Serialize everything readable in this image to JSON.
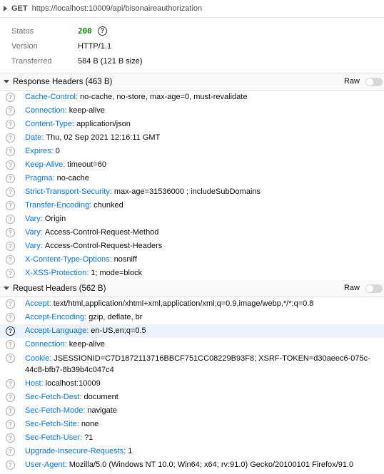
{
  "request": {
    "method": "GET",
    "url": "https://localhost:10009/api/bisonaireauthorization"
  },
  "summary": [
    {
      "label": "Status",
      "value": "200",
      "type": "status"
    },
    {
      "label": "Version",
      "value": "HTTP/1.1"
    },
    {
      "label": "Transferred",
      "value": "584 B (121 B size)"
    }
  ],
  "response_section": {
    "title": "Response Headers (463 B)",
    "raw_label": "Raw",
    "headers": [
      {
        "name": "Cache-Control:",
        "value": "no-cache, no-store, max-age=0, must-revalidate"
      },
      {
        "name": "Connection:",
        "value": "keep-alive"
      },
      {
        "name": "Content-Type:",
        "value": "application/json"
      },
      {
        "name": "Date:",
        "value": "Thu, 02 Sep 2021 12:16:11 GMT"
      },
      {
        "name": "Expires:",
        "value": "0"
      },
      {
        "name": "Keep-Alive:",
        "value": "timeout=60"
      },
      {
        "name": "Pragma:",
        "value": "no-cache"
      },
      {
        "name": "Strict-Transport-Security:",
        "value": "max-age=31536000 ; includeSubDomains"
      },
      {
        "name": "Transfer-Encoding:",
        "value": "chunked"
      },
      {
        "name": "Vary:",
        "value": "Origin"
      },
      {
        "name": "Vary:",
        "value": "Access-Control-Request-Method"
      },
      {
        "name": "Vary:",
        "value": "Access-Control-Request-Headers"
      },
      {
        "name": "X-Content-Type-Options:",
        "value": "nosniff"
      },
      {
        "name": "X-XSS-Protection:",
        "value": "1; mode=block"
      }
    ]
  },
  "request_section": {
    "title": "Request Headers (562 B)",
    "raw_label": "Raw",
    "headers": [
      {
        "name": "Accept:",
        "value": "text/html,application/xhtml+xml,application/xml;q=0.9,image/webp,*/*;q=0.8"
      },
      {
        "name": "Accept-Encoding:",
        "value": "gzip, deflate, br"
      },
      {
        "name": "Accept-Language:",
        "value": "en-US,en;q=0.5",
        "highlighted": true
      },
      {
        "name": "Connection:",
        "value": "keep-alive"
      },
      {
        "name": "Cookie:",
        "value": "JSESSIONID=C7D1872113716BBCF751CC08229B93F8; XSRF-TOKEN=d30aeec6-075c-44c8-bfb7-8b39b4c047c4",
        "wrap": true
      },
      {
        "name": "Host:",
        "value": "localhost:10009"
      },
      {
        "name": "Sec-Fetch-Dest:",
        "value": "document"
      },
      {
        "name": "Sec-Fetch-Mode:",
        "value": "navigate"
      },
      {
        "name": "Sec-Fetch-Site:",
        "value": "none"
      },
      {
        "name": "Sec-Fetch-User:",
        "value": "?1"
      },
      {
        "name": "Upgrade-Insecure-Requests:",
        "value": "1"
      },
      {
        "name": "User-Agent:",
        "value": "Mozilla/5.0 (Windows NT 10.0; Win64; x64; rv:91.0) Gecko/20100101 Firefox/91.0"
      }
    ]
  },
  "icons": {
    "help": "?",
    "collapse": "triangle-right",
    "expand": "triangle-down"
  }
}
